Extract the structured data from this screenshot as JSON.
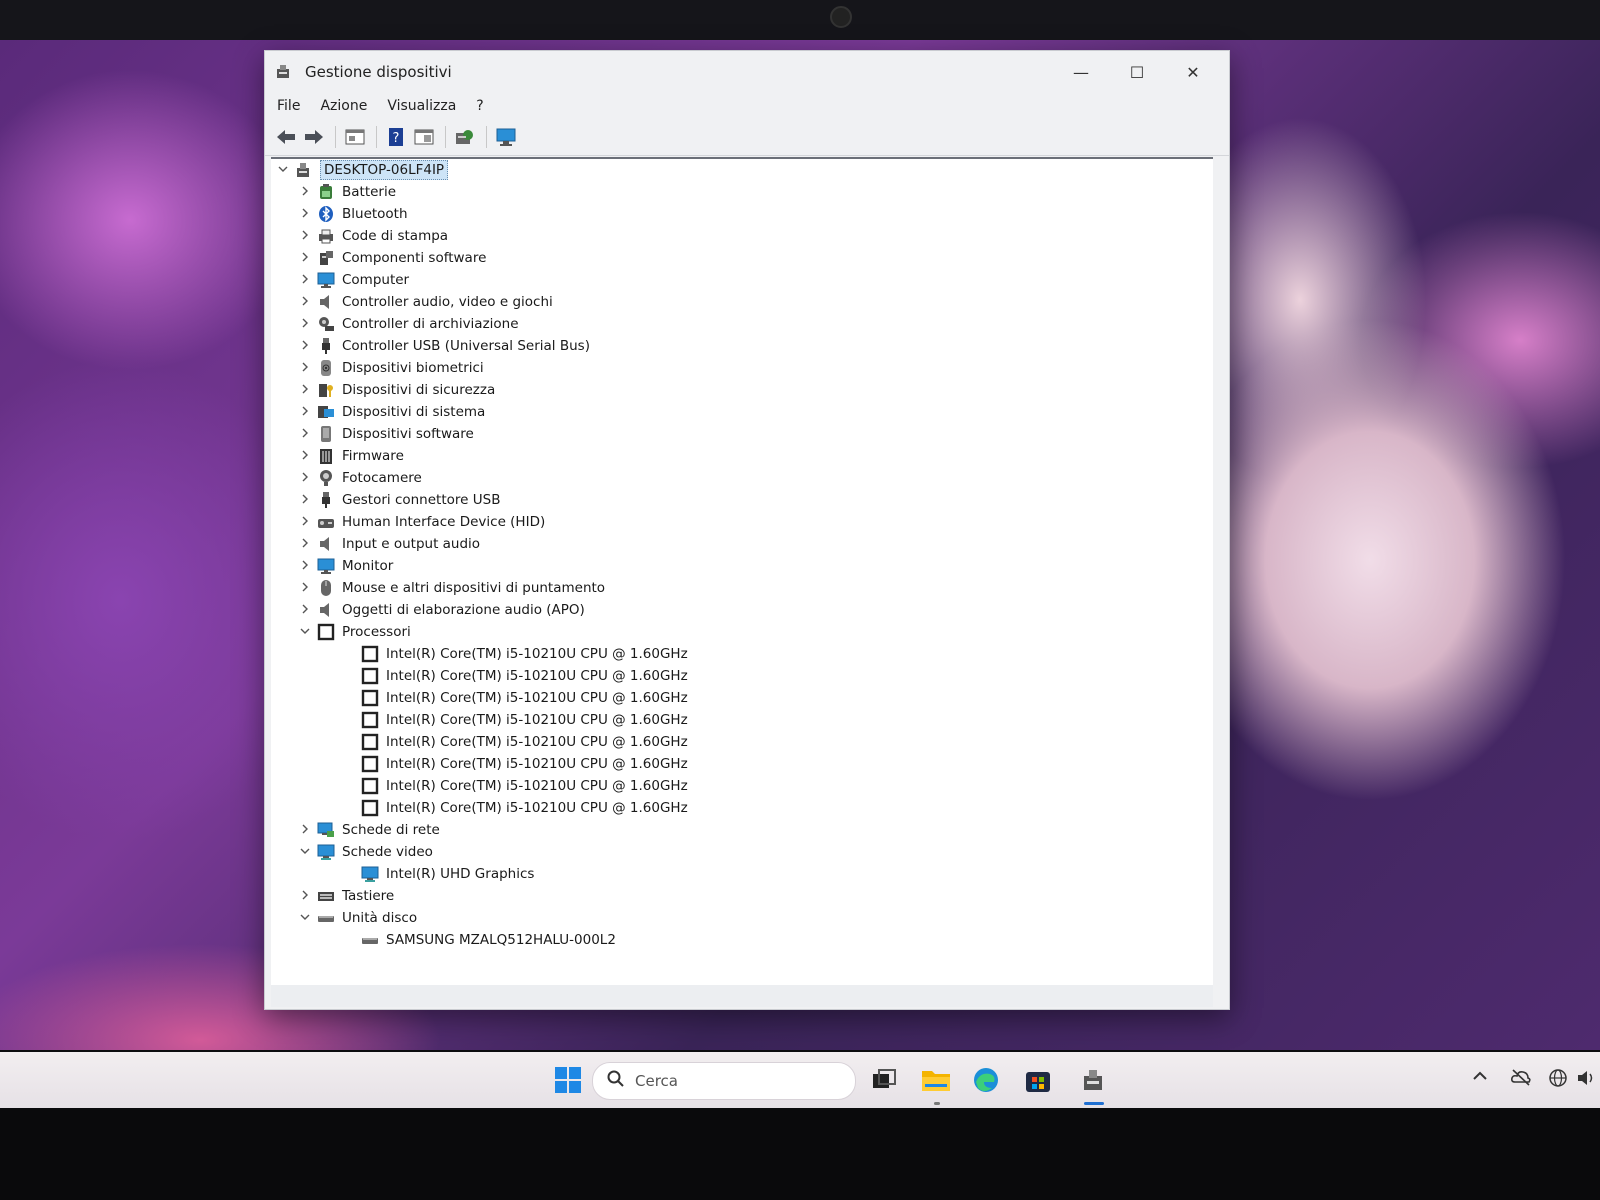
{
  "window": {
    "title": "Gestione dispositivi",
    "minimize_glyph": "—",
    "maximize_glyph": "☐",
    "close_glyph": "✕"
  },
  "menubar": {
    "items": [
      "File",
      "Azione",
      "Visualizza",
      "?"
    ]
  },
  "toolbar": {
    "buttons": [
      "back-arrow-icon",
      "forward-arrow-icon",
      "properties-icon",
      "help-icon",
      "view-icon",
      "update-driver-icon",
      "scan-hardware-icon"
    ]
  },
  "tree": {
    "root": "DESKTOP-06LF4IP",
    "categories": [
      {
        "label": "Batterie",
        "icon": "battery-icon",
        "expanded": false
      },
      {
        "label": "Bluetooth",
        "icon": "bluetooth-icon",
        "expanded": false
      },
      {
        "label": "Code di stampa",
        "icon": "printer-icon",
        "expanded": false
      },
      {
        "label": "Componenti software",
        "icon": "software-component-icon",
        "expanded": false
      },
      {
        "label": "Computer",
        "icon": "monitor-icon",
        "expanded": false
      },
      {
        "label": "Controller audio, video e giochi",
        "icon": "speaker-icon",
        "expanded": false
      },
      {
        "label": "Controller di archiviazione",
        "icon": "storage-controller-icon",
        "expanded": false
      },
      {
        "label": "Controller USB (Universal Serial Bus)",
        "icon": "usb-icon",
        "expanded": false
      },
      {
        "label": "Dispositivi biometrici",
        "icon": "biometric-icon",
        "expanded": false
      },
      {
        "label": "Dispositivi di sicurezza",
        "icon": "security-device-icon",
        "expanded": false
      },
      {
        "label": "Dispositivi di sistema",
        "icon": "system-device-icon",
        "expanded": false
      },
      {
        "label": "Dispositivi software",
        "icon": "software-device-icon",
        "expanded": false
      },
      {
        "label": "Firmware",
        "icon": "firmware-icon",
        "expanded": false
      },
      {
        "label": "Fotocamere",
        "icon": "camera-icon",
        "expanded": false
      },
      {
        "label": "Gestori connettore USB",
        "icon": "usb-icon",
        "expanded": false
      },
      {
        "label": "Human Interface Device (HID)",
        "icon": "hid-icon",
        "expanded": false
      },
      {
        "label": "Input e output audio",
        "icon": "speaker-icon",
        "expanded": false
      },
      {
        "label": "Monitor",
        "icon": "monitor-icon",
        "expanded": false
      },
      {
        "label": "Mouse e altri dispositivi di puntamento",
        "icon": "mouse-icon",
        "expanded": false
      },
      {
        "label": "Oggetti di elaborazione audio (APO)",
        "icon": "speaker-icon",
        "expanded": false
      },
      {
        "label": "Processori",
        "icon": "processor-icon",
        "expanded": true,
        "children": [
          "Intel(R) Core(TM) i5-10210U CPU @ 1.60GHz",
          "Intel(R) Core(TM) i5-10210U CPU @ 1.60GHz",
          "Intel(R) Core(TM) i5-10210U CPU @ 1.60GHz",
          "Intel(R) Core(TM) i5-10210U CPU @ 1.60GHz",
          "Intel(R) Core(TM) i5-10210U CPU @ 1.60GHz",
          "Intel(R) Core(TM) i5-10210U CPU @ 1.60GHz",
          "Intel(R) Core(TM) i5-10210U CPU @ 1.60GHz",
          "Intel(R) Core(TM) i5-10210U CPU @ 1.60GHz"
        ],
        "child_icon": "processor-icon"
      },
      {
        "label": "Schede di rete",
        "icon": "network-adapter-icon",
        "expanded": false
      },
      {
        "label": "Schede video",
        "icon": "display-adapter-icon",
        "expanded": true,
        "children": [
          "Intel(R) UHD Graphics"
        ],
        "child_icon": "display-adapter-icon"
      },
      {
        "label": "Tastiere",
        "icon": "keyboard-icon",
        "expanded": false
      },
      {
        "label": "Unità disco",
        "icon": "disk-drive-icon",
        "expanded": true,
        "children": [
          "SAMSUNG MZALQ512HALU-000L2"
        ],
        "child_icon": "disk-drive-icon"
      }
    ]
  },
  "taskbar": {
    "search_placeholder": "Cerca",
    "apps": [
      "start-icon",
      "task-view-icon",
      "file-explorer-icon",
      "edge-icon",
      "store-icon",
      "device-manager-icon"
    ],
    "tray": [
      "chevron-up-icon",
      "cloud-off-icon",
      "globe-icon",
      "volume-icon"
    ]
  },
  "colors": {
    "accent": "#1f6fd1",
    "selection": "#cde4f7"
  }
}
